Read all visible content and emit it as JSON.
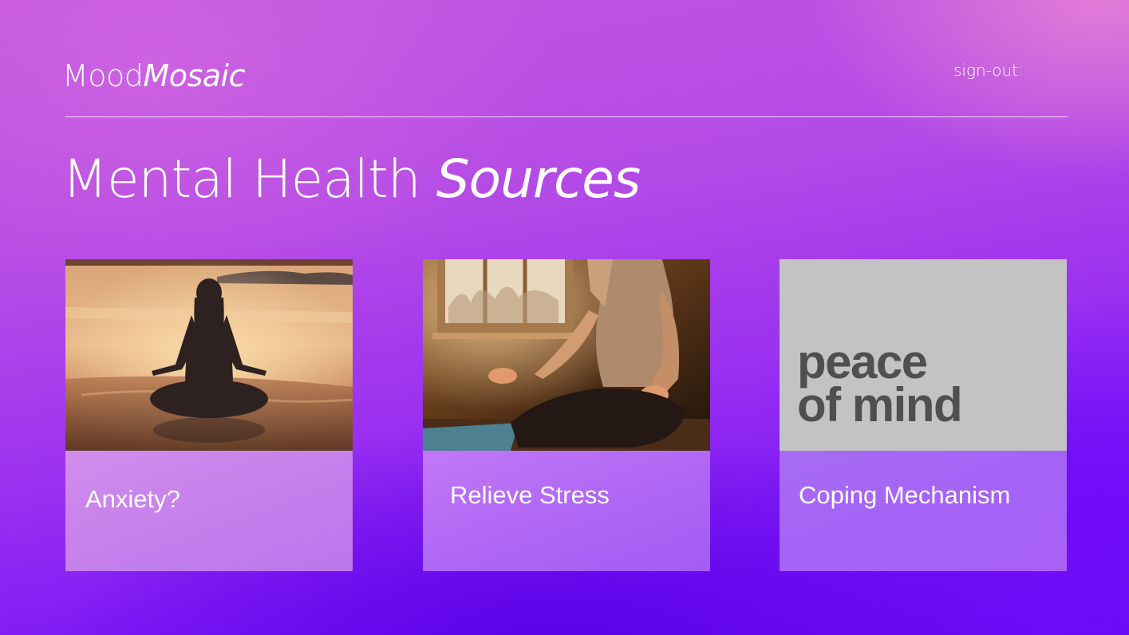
{
  "header": {
    "brand_part1": "Mood",
    "brand_part2": "Mosaic",
    "signout_label": "sign-out"
  },
  "page": {
    "title_part1": "Mental Health",
    "title_part2": "Sources"
  },
  "cards": [
    {
      "label": "Anxiety?",
      "image": "meditation-beach-sunset-photo"
    },
    {
      "label": "Relieve Stress",
      "image": "meditation-window-room-photo"
    },
    {
      "label": "Coping Mechanism",
      "image": "peace-of-mind-poster",
      "poster_line1": "peace",
      "poster_line2": "of mind"
    }
  ],
  "colors": {
    "background_top": "#c456df",
    "background_bottom": "#6a0af5",
    "text": "#ffffff",
    "poster_background": "#c3c3c3",
    "poster_text": "#4f4f4f"
  }
}
